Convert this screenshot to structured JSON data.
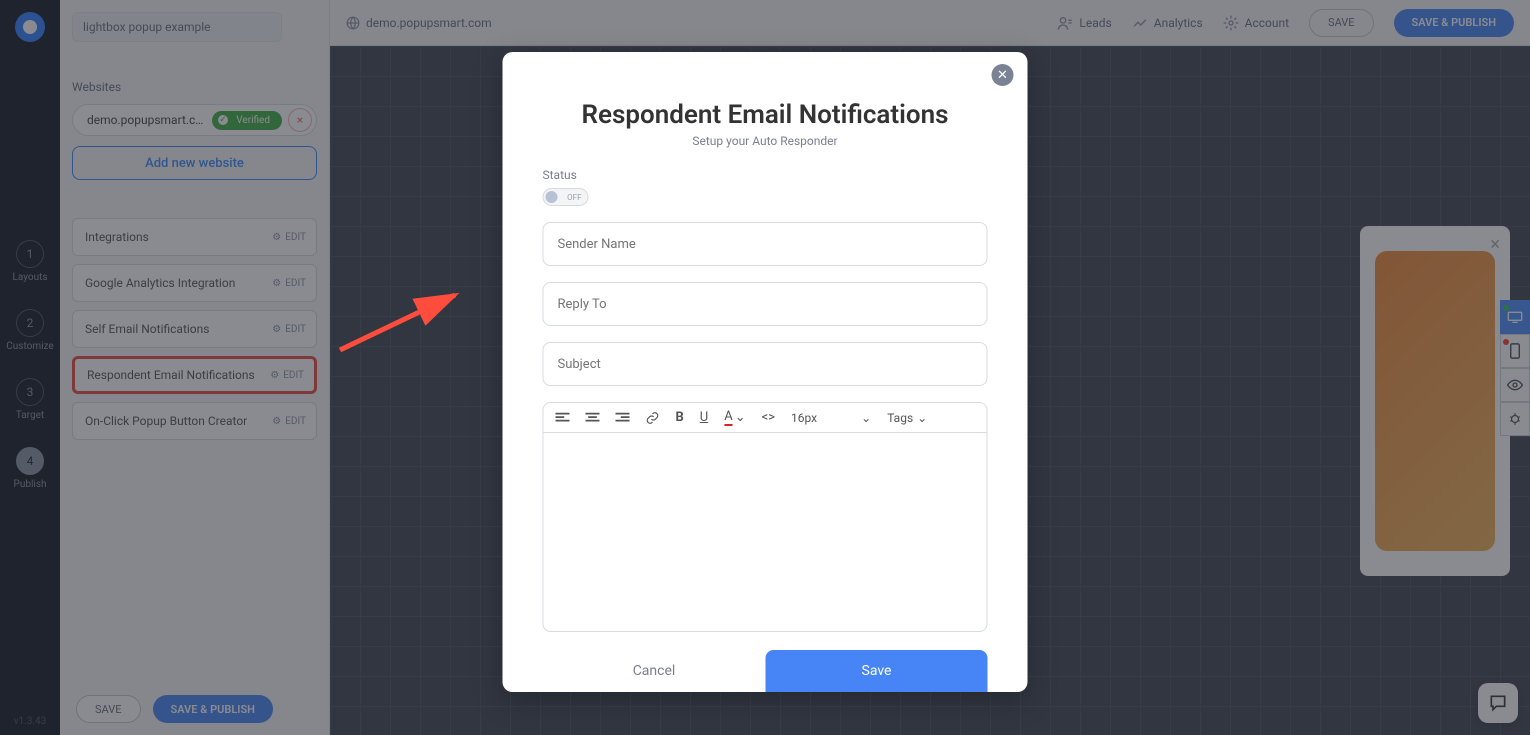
{
  "rail": {
    "steps": [
      {
        "num": "1",
        "label": "Layouts"
      },
      {
        "num": "2",
        "label": "Customize"
      },
      {
        "num": "3",
        "label": "Target"
      },
      {
        "num": "4",
        "label": "Publish"
      }
    ],
    "version": "v1.3.43"
  },
  "sidebar": {
    "campaign_name": "lightbox popup example",
    "domain": "demo.popupsmart.com",
    "websites_title": "Websites",
    "website_chip": "demo.popupsmart.c…",
    "verified_label": "Verified",
    "add_website": "Add new website",
    "rows": [
      {
        "label": "Integrations",
        "edit": "EDIT"
      },
      {
        "label": "Google Analytics Integration",
        "edit": "EDIT"
      },
      {
        "label": "Self Email Notifications",
        "edit": "EDIT"
      },
      {
        "label": "Respondent Email Notifications",
        "edit": "EDIT"
      },
      {
        "label": "On-Click Popup Button Creator",
        "edit": "EDIT"
      }
    ],
    "save": "SAVE",
    "publish": "SAVE & PUBLISH"
  },
  "topbar": {
    "domain": "demo.popupsmart.com",
    "leads": "Leads",
    "analytics": "Analytics",
    "account": "Account",
    "save": "SAVE",
    "publish": "SAVE & PUBLISH"
  },
  "modal": {
    "title": "Respondent Email Notifications",
    "subtitle": "Setup your Auto Responder",
    "status_label": "Status",
    "toggle_state": "OFF",
    "sender_ph": "Sender Name",
    "reply_ph": "Reply To",
    "subject_ph": "Subject",
    "font_size": "16px",
    "tags": "Tags",
    "cancel": "Cancel",
    "save": "Save"
  }
}
